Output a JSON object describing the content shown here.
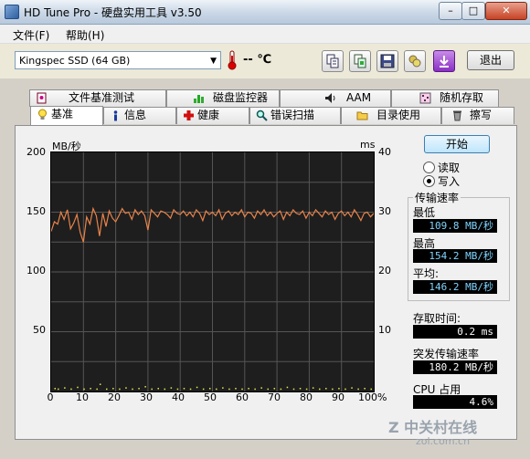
{
  "window": {
    "title": "HD Tune Pro - 硬盘实用工具 v3.50",
    "min": "–",
    "max": "□",
    "close": "✕"
  },
  "menu": [
    {
      "label": "文件(F)"
    },
    {
      "label": "帮助(H)"
    }
  ],
  "toolbar": {
    "drive": "Kingspec SSD (64 GB)",
    "temperature": "-- ℃",
    "buttons": [
      "copy-icon",
      "copy-info-icon",
      "save-icon",
      "screenshot-icon",
      "download-icon"
    ],
    "exit_label": "退出"
  },
  "tabs_top": [
    "文件基准测试",
    "磁盘监控器",
    "AAM",
    "随机存取"
  ],
  "tabs_bottom": [
    "基准",
    "信息",
    "健康",
    "错误扫描",
    "目录使用",
    "擦写"
  ],
  "active_tab": "基准",
  "start_button": "开始",
  "mode": {
    "read": "读取",
    "write": "写入",
    "selected": "写入"
  },
  "transfer": {
    "title": "传输速率",
    "min_label": "最低",
    "min_value": "109.8 MB/秒",
    "max_label": "最高",
    "max_value": "154.2 MB/秒",
    "avg_label": "平均:",
    "avg_value": "146.2 MB/秒"
  },
  "access": {
    "label": "存取时间:",
    "value": "0.2 ms"
  },
  "burst": {
    "label": "突发传输速率",
    "value": "180.2 MB/秒"
  },
  "cpu": {
    "label": "CPU 占用",
    "value": "4.6%"
  },
  "watermark": {
    "main": "Z 中关村在线",
    "sub": "zol.com.cn"
  },
  "chart_data": {
    "type": "line",
    "ylabel_left": "MB/秒",
    "ylabel_right": "ms",
    "y_ticks_left": [
      "200",
      "150",
      "100",
      "50"
    ],
    "y_ticks_right": [
      "40",
      "30",
      "20",
      "10"
    ],
    "x_ticks": [
      "0",
      "10",
      "20",
      "30",
      "40",
      "50",
      "60",
      "70",
      "80",
      "90",
      "100%"
    ],
    "ylim": [
      0,
      200
    ],
    "xlim": [
      0,
      100
    ],
    "colors": {
      "line": "#e8834a",
      "dots": "#e8e84a",
      "background": "#1e1e1e",
      "grid": "#555555"
    },
    "series": [
      {
        "x": [
          0,
          1,
          2,
          3,
          4,
          5,
          6,
          7,
          8,
          9,
          10,
          11,
          12,
          13,
          14,
          15,
          16,
          17,
          18,
          19,
          20,
          21,
          22,
          23,
          24,
          25,
          26,
          27,
          28,
          29,
          30,
          31,
          32,
          33,
          34,
          35,
          36,
          37,
          38,
          39,
          40,
          41,
          42,
          43,
          44,
          45,
          46,
          47,
          48,
          49,
          50,
          51,
          52,
          53,
          54,
          55,
          56,
          57,
          58,
          59,
          60,
          61,
          62,
          63,
          64,
          65,
          66,
          67,
          68,
          69,
          70,
          71,
          72,
          73,
          74,
          75,
          76,
          77,
          78,
          79,
          80,
          81,
          82,
          83,
          84,
          85,
          86,
          87,
          88,
          89,
          90,
          91,
          92,
          93,
          94,
          95,
          96,
          97,
          98,
          99,
          100
        ],
        "values": [
          134,
          142,
          140,
          150,
          144,
          152,
          136,
          141,
          148,
          133,
          125,
          146,
          140,
          153,
          147,
          130,
          149,
          138,
          151,
          145,
          142,
          147,
          153,
          149,
          150,
          144,
          152,
          148,
          151,
          147,
          135,
          152,
          149,
          146,
          151,
          150,
          148,
          145,
          152,
          149,
          148,
          151,
          147,
          150,
          146,
          152,
          149,
          143,
          151,
          148,
          150,
          147,
          152,
          144,
          149,
          151,
          147,
          150,
          148,
          152,
          146,
          150,
          149,
          145,
          151,
          148,
          152,
          147,
          150,
          146,
          149,
          151,
          144,
          150,
          147,
          152,
          149,
          148,
          151,
          145,
          150,
          147,
          152,
          149,
          146,
          151,
          148,
          150,
          144,
          149,
          151,
          147,
          150,
          146,
          152,
          148,
          143,
          149,
          150,
          146,
          149
        ]
      }
    ],
    "access_dots": {
      "x": [
        1,
        2,
        4,
        6,
        8,
        10,
        12,
        14,
        15,
        17,
        19,
        21,
        23,
        25,
        27,
        29,
        31,
        33,
        35,
        37,
        39,
        41,
        43,
        45,
        47,
        49,
        51,
        53,
        55,
        57,
        59,
        61,
        63,
        65,
        67,
        69,
        71,
        73,
        75,
        77,
        79,
        81,
        83,
        85,
        87,
        89,
        91,
        93,
        95,
        97,
        99
      ],
      "values_ms": [
        0.3,
        0.2,
        0.4,
        0.2,
        0.5,
        0.2,
        0.3,
        0.2,
        1.0,
        0.2,
        0.3,
        0.2,
        0.4,
        0.2,
        0.3,
        0.6,
        0.2,
        0.3,
        0.2,
        0.4,
        0.2,
        0.3,
        0.2,
        0.5,
        0.2,
        0.3,
        0.2,
        0.4,
        0.2,
        0.3,
        0.2,
        0.3,
        0.2,
        0.4,
        0.2,
        0.3,
        0.2,
        0.5,
        0.2,
        0.3,
        0.2,
        0.4,
        0.2,
        0.3,
        0.2,
        0.3,
        0.2,
        0.4,
        0.2,
        0.3,
        0.2
      ]
    }
  }
}
